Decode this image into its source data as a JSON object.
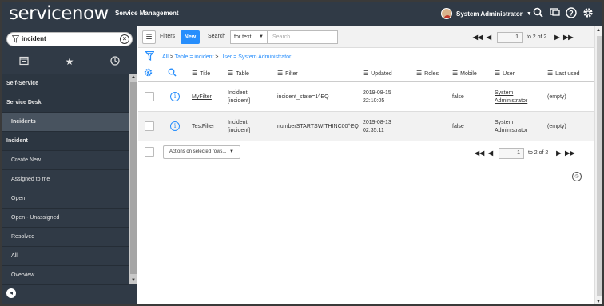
{
  "header": {
    "logo_text": "servicenow",
    "app_title": "Service Management",
    "user_name": "System Administrator",
    "icons": [
      "search-icon",
      "chat-icon",
      "help-icon",
      "gear-icon"
    ]
  },
  "sidebar": {
    "filter_value": "incident",
    "tabs": [
      "all-applications-icon",
      "favorites-star-icon",
      "history-clock-icon"
    ],
    "items": [
      {
        "label": "Self-Service",
        "kind": "section"
      },
      {
        "label": "Service Desk",
        "kind": "section"
      },
      {
        "label": "Incidents",
        "kind": "active"
      },
      {
        "label": "Incident",
        "kind": "section"
      },
      {
        "label": "Create New",
        "kind": "module"
      },
      {
        "label": "Assigned to me",
        "kind": "module"
      },
      {
        "label": "Open",
        "kind": "module"
      },
      {
        "label": "Open - Unassigned",
        "kind": "module"
      },
      {
        "label": "Resolved",
        "kind": "module"
      },
      {
        "label": "All",
        "kind": "module"
      },
      {
        "label": "Overview",
        "kind": "module"
      }
    ]
  },
  "toolbar": {
    "filters_label": "Filters",
    "new_label": "New",
    "search_label": "Search",
    "search_field": "for text",
    "search_placeholder": "Search"
  },
  "pager": {
    "current": "1",
    "range_text": "to 2 of 2"
  },
  "breadcrumb": {
    "all": "All",
    "sep1": " > ",
    "crumb1": "Table = incident",
    "sep2": " > ",
    "crumb2": "User = System Administrator"
  },
  "table": {
    "columns": [
      "Title",
      "Table",
      "Filter",
      "Updated",
      "Roles",
      "Mobile",
      "User",
      "Last used"
    ],
    "rows": [
      {
        "title": "MyFilter",
        "table_line1": "Incident",
        "table_line2": "[incident]",
        "filter": "incident_state=1^EQ",
        "updated_date": "2019-08-15",
        "updated_time": "22:10:05",
        "roles": "",
        "mobile": "false",
        "user_line1": "System",
        "user_line2": "Administrator",
        "last_used": "(empty)"
      },
      {
        "title": "TestFilter",
        "table_line1": "Incident",
        "table_line2": "[incident]",
        "filter": "numberSTARTSWITHINC00^EQ",
        "updated_date": "2019-08-13",
        "updated_time": "02:35:11",
        "roles": "",
        "mobile": "false",
        "user_line1": "System",
        "user_line2": "Administrator",
        "last_used": "(empty)"
      }
    ]
  },
  "footer": {
    "actions_label": "Actions on selected rows...",
    "pager_current": "1",
    "pager_range_text": "to 2 of 2"
  },
  "colors": {
    "header_bg": "#303a46",
    "accent": "#278efc"
  }
}
